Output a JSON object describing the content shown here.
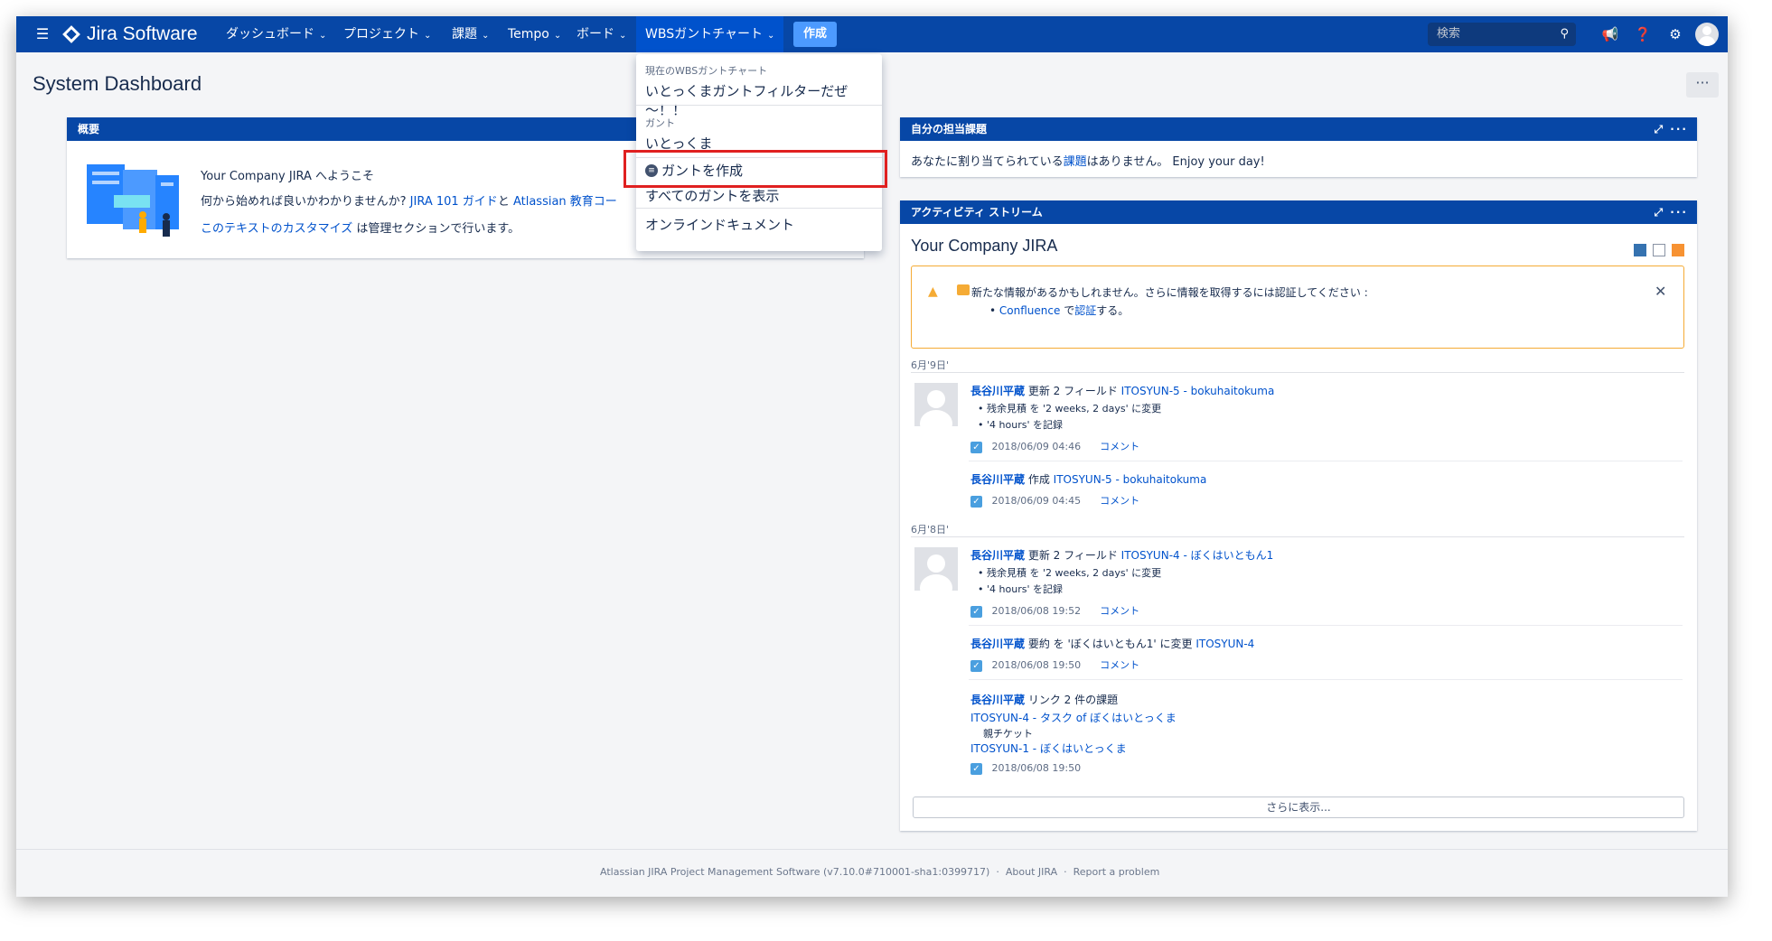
{
  "nav": {
    "logo_text": "Jira Software",
    "items": [
      {
        "label": "ダッシュボード"
      },
      {
        "label": "プロジェクト"
      },
      {
        "label": "課題"
      },
      {
        "label": "Tempo"
      },
      {
        "label": "ボード"
      },
      {
        "label": "WBSガントチャート"
      }
    ],
    "create_label": "作成",
    "search_placeholder": "検索"
  },
  "page": {
    "title": "System Dashboard",
    "more_label": "···"
  },
  "dropdown": {
    "section1_header": "現在のWBSガントチャート",
    "current_filter": "いとっくまガントフィルターだぜ～！！",
    "section2_header": "ガント",
    "gantt_item": "いとっくま",
    "create_gantt": "ガントを作成",
    "show_all": "すべてのガントを表示",
    "online_docs": "オンラインドキュメント"
  },
  "overview": {
    "title": "概要",
    "line1": "Your Company JIRA へようこそ",
    "line2_a": "何から始めれば良いかわかりませんか? ",
    "line2_link1": "JIRA 101 ガイド",
    "line2_b": "と ",
    "line2_link2": "Atlassian 教育コー",
    "line3_link": "このテキストのカスタマイズ",
    "line3_b": " は管理セクションで行います。"
  },
  "assigned": {
    "title": "自分の担当課題",
    "text_a": "あなたに割り当てられている",
    "text_link": "課題",
    "text_b": "はありません。 Enjoy your day!"
  },
  "activity": {
    "title": "アクティビティ ストリーム",
    "heading": "Your Company JIRA",
    "warning_text": "新たな情報があるかもしれません。さらに情報を取得するには認証してください :",
    "warning_link1": "Confluence",
    "warning_mid": " で",
    "warning_link2": "認証",
    "warning_end": "する。",
    "close_label": "✕",
    "date1": "6月'9日'",
    "date2": "6月'8日'",
    "e1_user": "長谷川平蔵",
    "e1_action": " 更新 2 フィールド ",
    "e1_issue": "ITOSYUN-5 - bokuhaitokuma",
    "e1_b1": "残余見積 を '2 weeks, 2 days' に変更",
    "e1_b2": "'4 hours' を記録",
    "e1_time": "2018/06/09 04:46",
    "comment": "コメント",
    "e2_user": "長谷川平蔵",
    "e2_action": " 作成 ",
    "e2_issue": "ITOSYUN-5 - bokuhaitokuma",
    "e2_time": "2018/06/09 04:45",
    "e3_user": "長谷川平蔵",
    "e3_action": " 更新 2 フィールド ",
    "e3_issue": "ITOSYUN-4 - ぼくはいともん1",
    "e3_b1": "残余見積 を '2 weeks, 2 days' に変更",
    "e3_b2": "'4 hours' を記録",
    "e3_time": "2018/06/08 19:52",
    "e4_user": "長谷川平蔵",
    "e4_action": " 要約 を 'ぼくはいともん1' に変更 ",
    "e4_issue": "ITOSYUN-4",
    "e4_time": "2018/06/08 19:50",
    "e5_user": "長谷川平蔵",
    "e5_action": " リンク 2 件の課題",
    "e5_link1": "ITOSYUN-4 - タスク of ぼくはいとっくま",
    "e5_note": "親チケット",
    "e5_link2": "ITOSYUN-1 - ぼくはいとっくま",
    "e5_time": "2018/06/08 19:50",
    "show_more": "さらに表示..."
  },
  "footer": {
    "text": "Atlassian JIRA Project Management Software (v7.10.0#710001-sha1:0399717)",
    "sep": "·",
    "about": "About JIRA",
    "report": "Report a problem"
  },
  "colors": {
    "nav_bg": "#0747a6",
    "create_btn": "#4c9aff",
    "link": "#0052cc",
    "highlight_box": "#e02020",
    "warning_border": "#f5ab35"
  }
}
